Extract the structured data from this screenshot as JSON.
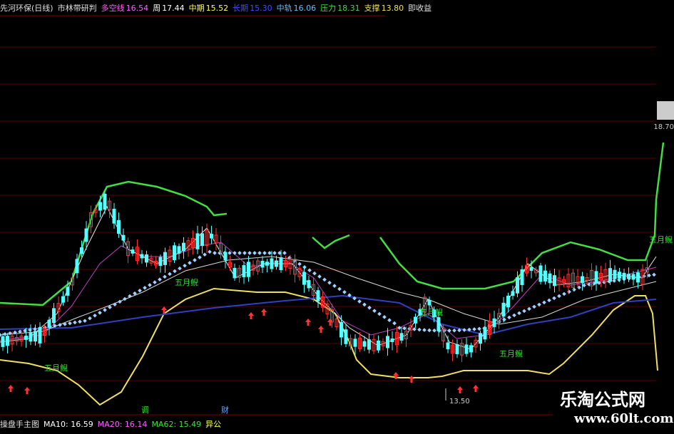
{
  "header": {
    "stock": "先河环保(日线)",
    "indicator": "市林带研判",
    "duokong_label": "多空线",
    "duokong_value": "16.54",
    "week_label": "周",
    "week_value": "17.44",
    "midterm_label": "中期",
    "midterm_value": "15.52",
    "longterm_label": "长期",
    "longterm_value": "15.30",
    "midtrack_label": "中轨",
    "midtrack_value": "16.06",
    "pressure_label": "压力",
    "pressure_value": "18.31",
    "support_label": "支撑",
    "support_value": "13.80",
    "tail": "即收益"
  },
  "footer": {
    "main_chart": "操盘手主图",
    "ma10": "MA10: 16.59",
    "ma20": "MA20: 16.14",
    "ma62": "MA62: 15.49",
    "extra": "异公"
  },
  "labels": {
    "wuyue1": "五月鲵",
    "wuyue2": "五月鲵",
    "wuyue3": "五月鲵",
    "wuyue4": "五月鲵",
    "wuyue5": "五月鲵",
    "low_price": "13.50",
    "high_price": "18.70",
    "axis_a": "调",
    "axis_b": "财"
  },
  "watermark": {
    "line1": "乐淘公式网",
    "line2": "www.60lt.com"
  },
  "colors": {
    "bg": "#000000",
    "up": "#ff3333",
    "down": "#55ffff",
    "green_band": "#44dd44",
    "yellow_band": "#f0e060",
    "blue_line": "#3040c0",
    "ma_white": "#d8d8d8",
    "ma_purple": "#c040c0",
    "dots": "#a0d0ff",
    "grid": "#5a0000",
    "label_green": "#33dd33"
  }
}
